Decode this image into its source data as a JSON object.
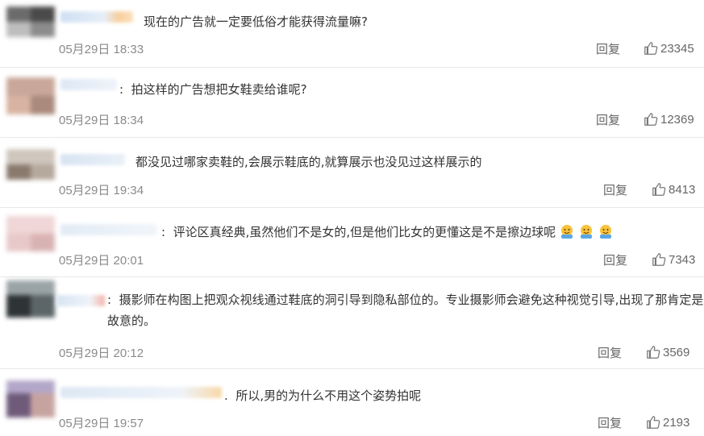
{
  "comments": [
    {
      "prefix": "",
      "text": "现在的广告就一定要低俗才能获得流量嘛?",
      "date": "05月29日 18:33",
      "reply": "回复",
      "likes": "23345"
    },
    {
      "prefix": ":",
      "text": "拍这样的广告想把女鞋卖给谁呢?",
      "date": "05月29日 18:34",
      "reply": "回复",
      "likes": "12369"
    },
    {
      "prefix": "",
      "text": "都没见过哪家卖鞋的,会展示鞋底的,就算展示也没见过这样展示的",
      "date": "05月29日 19:34",
      "reply": "回复",
      "likes": "8413"
    },
    {
      "prefix": ":",
      "text": "评论区真经典,虽然他们不是女的,但是他们比女的更懂这是不是擦边球呢",
      "date": "05月29日 20:01",
      "reply": "回复",
      "likes": "7343"
    },
    {
      "prefix": ":",
      "text": "摄影师在构图上把观众视线通过鞋底的洞引导到隐私部位的。专业摄影师会避免这种视觉引导,出现了那肯定是故意的。",
      "date": "05月29日 20:12",
      "reply": "回复",
      "likes": "3569"
    },
    {
      "prefix": ".",
      "text": "所以,男的为什么不用这个姿势拍呢",
      "date": "05月29日 19:57",
      "reply": "回复",
      "likes": "2193"
    }
  ]
}
